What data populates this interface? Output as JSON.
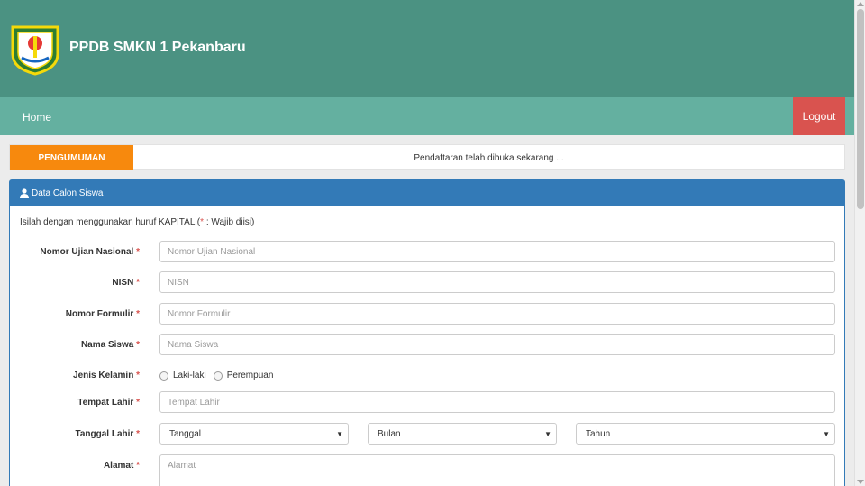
{
  "header": {
    "title": "PPDB SMKN 1 Pekanbaru",
    "logo_icon": "school-crest-icon"
  },
  "nav": {
    "home": "Home",
    "logout": "Logout"
  },
  "announcement": {
    "label": "PENGUMUMAN",
    "text": "Pendaftaran telah dibuka sekarang ..."
  },
  "panel": {
    "title": "Data Calon Siswa",
    "icon": "user-icon",
    "intro_text": "Isilah dengan menggunakan huruf KAPITAL (",
    "intro_star": "*",
    "intro_rest": " : Wajib diisi)"
  },
  "form": {
    "required_mark": "*",
    "nomor_ujian": {
      "label": "Nomor Ujian Nasional",
      "placeholder": "Nomor Ujian Nasional"
    },
    "nisn": {
      "label": "NISN",
      "placeholder": "NISN"
    },
    "nomor_formulir": {
      "label": "Nomor Formulir",
      "placeholder": "Nomor Formulir"
    },
    "nama_siswa": {
      "label": "Nama Siswa",
      "placeholder": "Nama Siswa"
    },
    "jenis_kelamin": {
      "label": "Jenis Kelamin",
      "options": [
        "Laki-laki",
        "Perempuan"
      ]
    },
    "tempat_lahir": {
      "label": "Tempat Lahir",
      "placeholder": "Tempat Lahir"
    },
    "tanggal_lahir": {
      "label": "Tanggal Lahir",
      "tanggal": "Tanggal",
      "bulan": "Bulan",
      "tahun": "Tahun"
    },
    "alamat": {
      "label": "Alamat",
      "placeholder": "Alamat"
    }
  },
  "colors": {
    "header": "#4b9282",
    "navbar": "#64b0a0",
    "logout": "#d9534f",
    "announce": "#f7890d",
    "panel": "#337ab7"
  }
}
